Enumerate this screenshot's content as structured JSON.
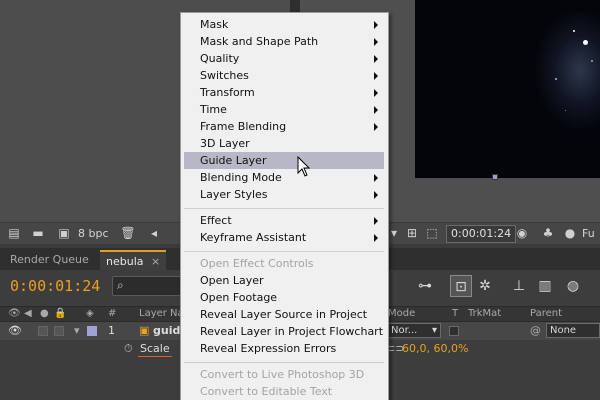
{
  "project_footer": {
    "bpc_label": "8 bpc",
    "icons": [
      "interpret-footage-icon",
      "new-folder-icon",
      "new-composition-icon",
      "trash-icon"
    ]
  },
  "comp_footer": {
    "timecode": "0:00:01:24",
    "icons": [
      "fast-preview-icon",
      "camera-snapshot-icon",
      "show-channel-icon"
    ],
    "partial_label": "Fu"
  },
  "tabs": [
    {
      "label": "Render Queue"
    },
    {
      "label": "nebula"
    }
  ],
  "timeline": {
    "current_time": "0:00:01:24",
    "columns": {
      "number": "#",
      "layer_name": "Layer Nar",
      "mode": "Mode",
      "t": "T",
      "trkmat": "TrkMat",
      "parent": "Parent"
    },
    "layer": {
      "number": "1",
      "name": "guid",
      "mode": "Nor...",
      "parent": "None",
      "label_color": "#9da3d6"
    },
    "property": {
      "name": "Scale",
      "value": "60,0, 60,0%"
    }
  },
  "context_menu": {
    "items": [
      {
        "label": "Mask",
        "submenu": true
      },
      {
        "label": "Mask and Shape Path",
        "submenu": true
      },
      {
        "label": "Quality",
        "submenu": true
      },
      {
        "label": "Switches",
        "submenu": true
      },
      {
        "label": "Transform",
        "submenu": true
      },
      {
        "label": "Time",
        "submenu": true
      },
      {
        "label": "Frame Blending",
        "submenu": true
      },
      {
        "label": "3D Layer",
        "submenu": false
      },
      {
        "label": "Guide Layer",
        "submenu": false,
        "highlighted": true
      },
      {
        "label": "Blending Mode",
        "submenu": true
      },
      {
        "label": "Layer Styles",
        "submenu": true
      },
      {
        "label": "Effect",
        "submenu": true
      },
      {
        "label": "Keyframe Assistant",
        "submenu": true
      },
      {
        "label": "Open Effect Controls",
        "disabled": true
      },
      {
        "label": "Open Layer"
      },
      {
        "label": "Open Footage"
      },
      {
        "label": "Reveal Layer Source in Project"
      },
      {
        "label": "Reveal Layer in Project Flowchart"
      },
      {
        "label": "Reveal Expression Errors"
      },
      {
        "label": "Convert to Live Photoshop 3D",
        "disabled": true
      },
      {
        "label": "Convert to Editable Text",
        "disabled": true
      }
    ]
  },
  "colors": {
    "accent_time": "#e8a21d",
    "menu_highlight": "#b8b7c8",
    "tab_accent": "#e0a020"
  }
}
